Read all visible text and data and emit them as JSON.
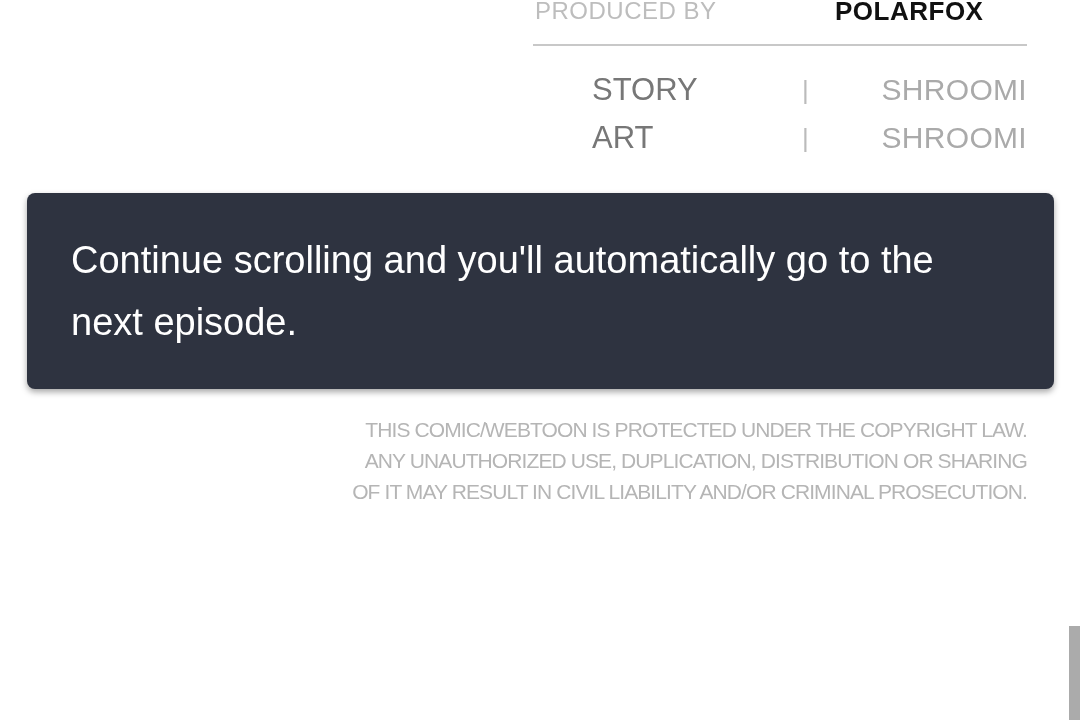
{
  "credits": {
    "produced_by_label": "PRODUCED BY",
    "producer": "POLARFOX",
    "roles": [
      {
        "role": "STORY",
        "separator": "|",
        "name": "SHROOMI"
      },
      {
        "role": "ART",
        "separator": "|",
        "name": "SHROOMI"
      }
    ]
  },
  "copyright_notice": [
    "THIS COMIC/WEBTOON IS PROTECTED UNDER THE COPYRIGHT LAW.",
    "ANY UNAUTHORIZED USE, DUPLICATION, DISTRIBUTION OR SHARING",
    "OF IT MAY RESULT IN CIVIL LIABILITY AND/OR CRIMINAL PROSECUTION."
  ],
  "toast": {
    "message": "Continue scrolling and you'll automatically go to the next episode."
  }
}
